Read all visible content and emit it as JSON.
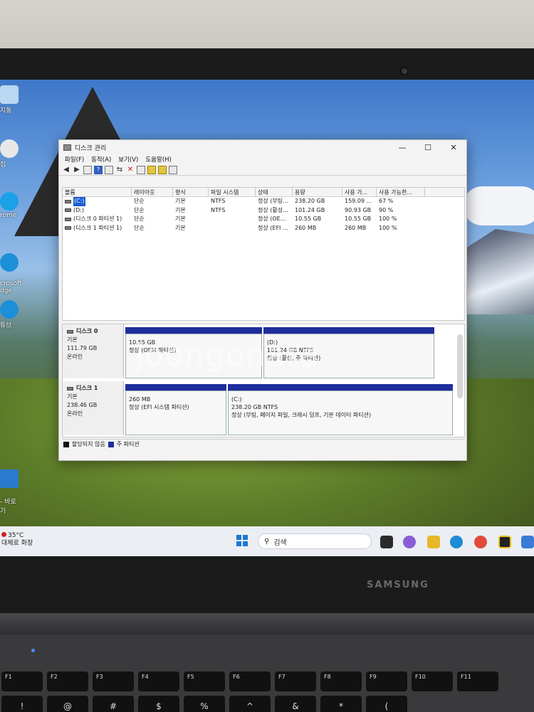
{
  "desktop": {
    "icons": [
      {
        "label": "지통",
        "icon": "recycle-bin-icon"
      },
      {
        "label": "집",
        "icon": "folder-icon"
      },
      {
        "label": "rome",
        "icon": "chrome-icon"
      },
      {
        "label": "crosoft\ndge",
        "icon": "edge-icon"
      },
      {
        "label": "튜브",
        "icon": "youtube-icon"
      },
      {
        "label": "- 바로\n기",
        "icon": "shortcut-icon"
      }
    ]
  },
  "window": {
    "title": "디스크 관리",
    "menu": [
      "파일(F)",
      "동작(A)",
      "보기(V)",
      "도움말(H)"
    ],
    "controls": {
      "minimize": "—",
      "maximize": "☐",
      "close": "✕"
    }
  },
  "volumes": {
    "headers": [
      "볼륨",
      "레이아웃",
      "형식",
      "파일 시스템",
      "상태",
      "용량",
      "사용 가...",
      "사용 가능한..."
    ],
    "rows": [
      {
        "volume": "(C:)",
        "layout": "단순",
        "type": "기본",
        "fs": "NTFS",
        "status": "정상 (부팅...",
        "capacity": "238.20 GB",
        "free": "159.09 ...",
        "pct": "67 %",
        "selected": true
      },
      {
        "volume": "(D:)",
        "layout": "단순",
        "type": "기본",
        "fs": "NTFS",
        "status": "정상 (활성...",
        "capacity": "101.24 GB",
        "free": "90.93 GB",
        "pct": "90 %"
      },
      {
        "volume": "(디스크 0 파티션 1)",
        "layout": "단순",
        "type": "기본",
        "fs": "",
        "status": "정상 (OE...",
        "capacity": "10.55 GB",
        "free": "10.55 GB",
        "pct": "100 %"
      },
      {
        "volume": "(디스크 1 파티션 1)",
        "layout": "단순",
        "type": "기본",
        "fs": "",
        "status": "정상 (EFI ...",
        "capacity": "260 MB",
        "free": "260 MB",
        "pct": "100 %"
      }
    ]
  },
  "disks": [
    {
      "name": "디스크 0",
      "kind": "기본",
      "size": "111.79 GB",
      "state": "온라인",
      "partitions": [
        {
          "title": "",
          "size": "10.55 GB",
          "status": "정상 (OEM 파티션)"
        },
        {
          "title": "(D:)",
          "size": "101.24 GB NTFS",
          "status": "정상 (활성, 주 파티션)"
        }
      ]
    },
    {
      "name": "디스크 1",
      "kind": "기본",
      "size": "238.46 GB",
      "state": "온라인",
      "partitions": [
        {
          "title": "",
          "size": "260 MB",
          "status": "정상 (EFI 시스템 파티션)"
        },
        {
          "title": "(C:)",
          "size": "238.20 GB NTFS",
          "status": "정상 (부팅, 페이지 파일, 크래시 덤프, 기본 데이터 파티션)"
        }
      ]
    }
  ],
  "legend": {
    "unallocated": "할당되지 않음",
    "primary": "주 파티션"
  },
  "watermark": "joongonara",
  "taskbar": {
    "temperature": "35°C",
    "weather_text": "대체로 화창",
    "search_placeholder": "검색"
  },
  "laptop": {
    "brand": "SAMSUNG",
    "fn_keys": [
      "F1",
      "F2",
      "F3",
      "F4",
      "F5",
      "F6",
      "F7",
      "F8",
      "F9",
      "F10",
      "F11"
    ],
    "num_keys": [
      "!",
      "@",
      "#",
      "$",
      "%",
      "^",
      "&",
      "*",
      "("
    ]
  },
  "colors": {
    "primary_partition": "#1e2e9c",
    "unallocated": "#111111",
    "selection": "#1b5bd1"
  }
}
